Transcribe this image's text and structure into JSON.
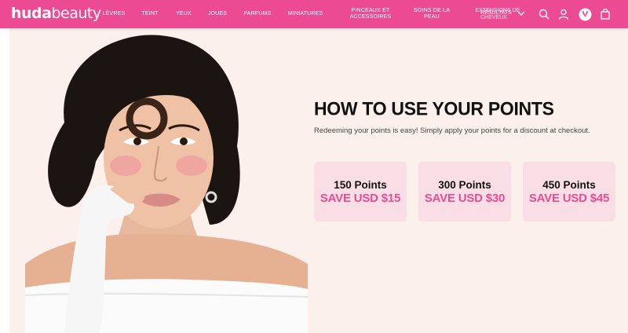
{
  "header": {
    "logo_bold": "huda",
    "logo_light": "beauty",
    "nav": [
      {
        "label": "LÈVRES"
      },
      {
        "label": "TEINT"
      },
      {
        "label": "YEUX"
      },
      {
        "label": "JOUES"
      },
      {
        "label": "PARFUMS"
      },
      {
        "label": "MINIATURES"
      },
      {
        "label": "PINCEAUX ET ACCESSOIRES"
      },
      {
        "label": "SOINS DE LA PEAU"
      }
    ],
    "nav_overlap": {
      "back": "EXTENSIONS DE",
      "front": "RÉSULTATS",
      "back2": "CHEVEUX"
    },
    "accent_color": "#ec4b94"
  },
  "main": {
    "title": "HOW TO USE YOUR POINTS",
    "subtitle": "Redeeming your points is easy! Simply apply your points for a discount at checkout.",
    "cards": [
      {
        "points": "150 Points",
        "save": "SAVE USD $15"
      },
      {
        "points": "300 Points",
        "save": "SAVE USD $30"
      },
      {
        "points": "450 Points",
        "save": "SAVE USD $45"
      }
    ],
    "background_color": "#fbf0eb",
    "card_color": "#f9dfe5"
  },
  "icons": [
    "chevron-down-icon",
    "search-icon",
    "account-icon",
    "rewards-icon",
    "bag-icon"
  ]
}
